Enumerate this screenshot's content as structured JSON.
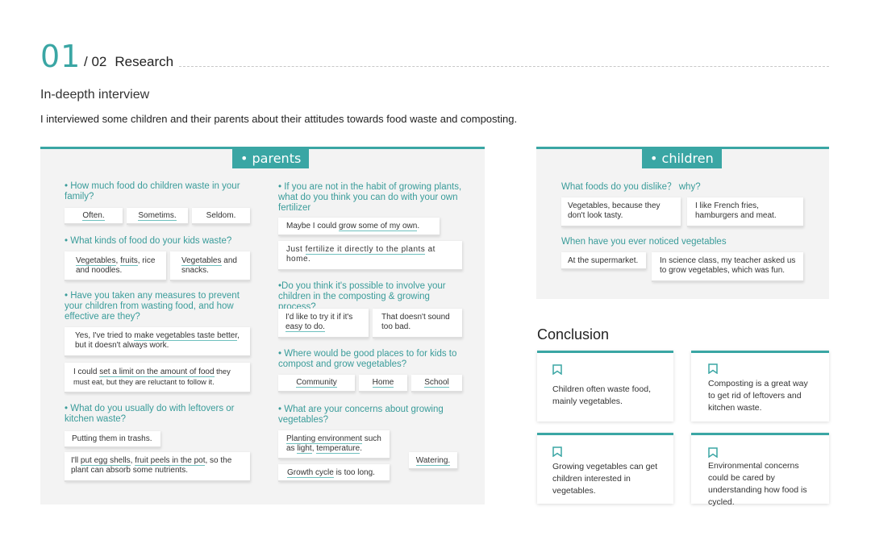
{
  "header": {
    "number": "01",
    "section": "/ 02",
    "title": "Research",
    "heading": "In-deepth interview",
    "intro": "I interviewed some children and their parents about their attitudes towards food waste and composting."
  },
  "parents": {
    "tag": "• parents",
    "q1": "• How much food do children waste in your family?",
    "q1_answers": [
      "Often.",
      "Sometims.",
      "Seldom."
    ],
    "q2": "• What kinds of food do your kids waste?",
    "q2_a1_part1": "Vegetables",
    "q2_a1_part2": ",",
    "q2_a1_part3": "fruits",
    "q2_a1_part4": ", rice and noodles.",
    "q2_a2_part1": "Vegetables",
    "q2_a2_part2": " and snacks.",
    "q3": "• Have you taken any measures to prevent your children from wasting food, and how effective are they?",
    "q3_a1_part1": "Yes, I've tried to ",
    "q3_a1_part2": "make vegetables taste better",
    "q3_a1_part3": ", but it doesn't always work.",
    "q3_a2_part1": "I could ",
    "q3_a2_part2": "set a limit on the amount of food",
    "q3_a2_part3": " they must eat, but they are reluctant to follow it.",
    "q4": "• What do you usually do with leftovers or kitchen waste?",
    "q4_a1": "Putting them in trashs.",
    "q4_a2_part1": "I'll ",
    "q4_a2_part2": "put egg shells",
    "q4_a2_part3": ", ",
    "q4_a2_part4": "fruit peels in the pot",
    "q4_a2_part5": ", so the plant can absorb some nutrients.",
    "q5": "• If you are not in the habit of growing plants, what do you think you can do with your own fertilizer",
    "q5_a1_part1": "Maybe I could ",
    "q5_a1_part2": "grow some of my own",
    "q5_a1_part3": ".",
    "q5_a2_part1": "Just ",
    "q5_a2_part2": "fertilize it directly to the plants",
    "q5_a2_part3": " at home.",
    "q6": "•Do you think it's possible to involve your children in the composting & growing process?",
    "q6_a1_part1": "I'd like to try it if it's ",
    "q6_a1_part2": "easy to do.",
    "q6_a2": "That doesn't sound too bad.",
    "q7": "• Where would be good places to for kids to compost and grow vegetables?",
    "q7_answers": [
      "Community",
      "Home",
      "School"
    ],
    "q8": "• What are your concerns about growing vegetables?",
    "q8_a1_part1": "Planting environment",
    "q8_a1_part2": " such as ",
    "q8_a1_part3": "light",
    "q8_a1_part4": ", ",
    "q8_a1_part5": "temperature",
    "q8_a1_part6": ".",
    "q8_a2_part1": "Growth cycle",
    "q8_a2_part2": " is too long.",
    "q8_a3": "Watering."
  },
  "children": {
    "tag": "• children",
    "q1": "What foods do you dislike？ why?",
    "q1_a1": "Vegetables, because they don't look tasty.",
    "q1_a2": "I like French fries, hamburgers and meat.",
    "q2": "When have you ever noticed vegetables",
    "q2_a1": "At the supermarket.",
    "q2_a2": "In science class, my teacher asked us to grow vegetables, which was fun."
  },
  "conclusion": {
    "title": "Conclusion",
    "icon": "bookmark-icon",
    "items": [
      "Children often waste food, mainly vegetables.",
      "Composting is a great way to get rid of leftovers and kitchen waste.",
      "Growing vegetables can get children interested in vegetables.",
      "Environmental concerns could be cared by understanding how food is cycled."
    ]
  },
  "colors": {
    "accent": "#3aa6a4",
    "panel": "#f3f3f3"
  }
}
